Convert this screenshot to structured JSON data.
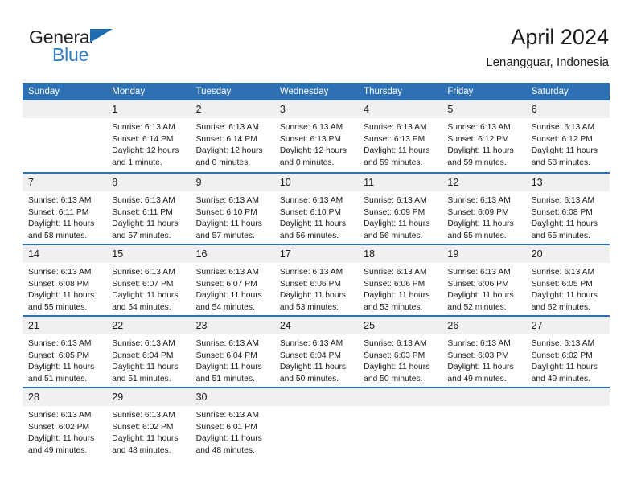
{
  "brand": {
    "name_part1": "General",
    "name_part2": "Blue"
  },
  "header": {
    "title": "April 2024",
    "location": "Lenangguar, Indonesia"
  },
  "colors": {
    "header_blue": "#2e70b4",
    "brand_blue": "#2e7bc4",
    "daynum_band": "#f0f0f0",
    "text": "#1a1a1a"
  },
  "weekdays": [
    "Sunday",
    "Monday",
    "Tuesday",
    "Wednesday",
    "Thursday",
    "Friday",
    "Saturday"
  ],
  "weeks": [
    [
      {
        "day": "",
        "empty": true
      },
      {
        "day": "1",
        "sunrise": "Sunrise: 6:13 AM",
        "sunset": "Sunset: 6:14 PM",
        "daylight1": "Daylight: 12 hours",
        "daylight2": "and 1 minute."
      },
      {
        "day": "2",
        "sunrise": "Sunrise: 6:13 AM",
        "sunset": "Sunset: 6:14 PM",
        "daylight1": "Daylight: 12 hours",
        "daylight2": "and 0 minutes."
      },
      {
        "day": "3",
        "sunrise": "Sunrise: 6:13 AM",
        "sunset": "Sunset: 6:13 PM",
        "daylight1": "Daylight: 12 hours",
        "daylight2": "and 0 minutes."
      },
      {
        "day": "4",
        "sunrise": "Sunrise: 6:13 AM",
        "sunset": "Sunset: 6:13 PM",
        "daylight1": "Daylight: 11 hours",
        "daylight2": "and 59 minutes."
      },
      {
        "day": "5",
        "sunrise": "Sunrise: 6:13 AM",
        "sunset": "Sunset: 6:12 PM",
        "daylight1": "Daylight: 11 hours",
        "daylight2": "and 59 minutes."
      },
      {
        "day": "6",
        "sunrise": "Sunrise: 6:13 AM",
        "sunset": "Sunset: 6:12 PM",
        "daylight1": "Daylight: 11 hours",
        "daylight2": "and 58 minutes."
      }
    ],
    [
      {
        "day": "7",
        "sunrise": "Sunrise: 6:13 AM",
        "sunset": "Sunset: 6:11 PM",
        "daylight1": "Daylight: 11 hours",
        "daylight2": "and 58 minutes."
      },
      {
        "day": "8",
        "sunrise": "Sunrise: 6:13 AM",
        "sunset": "Sunset: 6:11 PM",
        "daylight1": "Daylight: 11 hours",
        "daylight2": "and 57 minutes."
      },
      {
        "day": "9",
        "sunrise": "Sunrise: 6:13 AM",
        "sunset": "Sunset: 6:10 PM",
        "daylight1": "Daylight: 11 hours",
        "daylight2": "and 57 minutes."
      },
      {
        "day": "10",
        "sunrise": "Sunrise: 6:13 AM",
        "sunset": "Sunset: 6:10 PM",
        "daylight1": "Daylight: 11 hours",
        "daylight2": "and 56 minutes."
      },
      {
        "day": "11",
        "sunrise": "Sunrise: 6:13 AM",
        "sunset": "Sunset: 6:09 PM",
        "daylight1": "Daylight: 11 hours",
        "daylight2": "and 56 minutes."
      },
      {
        "day": "12",
        "sunrise": "Sunrise: 6:13 AM",
        "sunset": "Sunset: 6:09 PM",
        "daylight1": "Daylight: 11 hours",
        "daylight2": "and 55 minutes."
      },
      {
        "day": "13",
        "sunrise": "Sunrise: 6:13 AM",
        "sunset": "Sunset: 6:08 PM",
        "daylight1": "Daylight: 11 hours",
        "daylight2": "and 55 minutes."
      }
    ],
    [
      {
        "day": "14",
        "sunrise": "Sunrise: 6:13 AM",
        "sunset": "Sunset: 6:08 PM",
        "daylight1": "Daylight: 11 hours",
        "daylight2": "and 55 minutes."
      },
      {
        "day": "15",
        "sunrise": "Sunrise: 6:13 AM",
        "sunset": "Sunset: 6:07 PM",
        "daylight1": "Daylight: 11 hours",
        "daylight2": "and 54 minutes."
      },
      {
        "day": "16",
        "sunrise": "Sunrise: 6:13 AM",
        "sunset": "Sunset: 6:07 PM",
        "daylight1": "Daylight: 11 hours",
        "daylight2": "and 54 minutes."
      },
      {
        "day": "17",
        "sunrise": "Sunrise: 6:13 AM",
        "sunset": "Sunset: 6:06 PM",
        "daylight1": "Daylight: 11 hours",
        "daylight2": "and 53 minutes."
      },
      {
        "day": "18",
        "sunrise": "Sunrise: 6:13 AM",
        "sunset": "Sunset: 6:06 PM",
        "daylight1": "Daylight: 11 hours",
        "daylight2": "and 53 minutes."
      },
      {
        "day": "19",
        "sunrise": "Sunrise: 6:13 AM",
        "sunset": "Sunset: 6:06 PM",
        "daylight1": "Daylight: 11 hours",
        "daylight2": "and 52 minutes."
      },
      {
        "day": "20",
        "sunrise": "Sunrise: 6:13 AM",
        "sunset": "Sunset: 6:05 PM",
        "daylight1": "Daylight: 11 hours",
        "daylight2": "and 52 minutes."
      }
    ],
    [
      {
        "day": "21",
        "sunrise": "Sunrise: 6:13 AM",
        "sunset": "Sunset: 6:05 PM",
        "daylight1": "Daylight: 11 hours",
        "daylight2": "and 51 minutes."
      },
      {
        "day": "22",
        "sunrise": "Sunrise: 6:13 AM",
        "sunset": "Sunset: 6:04 PM",
        "daylight1": "Daylight: 11 hours",
        "daylight2": "and 51 minutes."
      },
      {
        "day": "23",
        "sunrise": "Sunrise: 6:13 AM",
        "sunset": "Sunset: 6:04 PM",
        "daylight1": "Daylight: 11 hours",
        "daylight2": "and 51 minutes."
      },
      {
        "day": "24",
        "sunrise": "Sunrise: 6:13 AM",
        "sunset": "Sunset: 6:04 PM",
        "daylight1": "Daylight: 11 hours",
        "daylight2": "and 50 minutes."
      },
      {
        "day": "25",
        "sunrise": "Sunrise: 6:13 AM",
        "sunset": "Sunset: 6:03 PM",
        "daylight1": "Daylight: 11 hours",
        "daylight2": "and 50 minutes."
      },
      {
        "day": "26",
        "sunrise": "Sunrise: 6:13 AM",
        "sunset": "Sunset: 6:03 PM",
        "daylight1": "Daylight: 11 hours",
        "daylight2": "and 49 minutes."
      },
      {
        "day": "27",
        "sunrise": "Sunrise: 6:13 AM",
        "sunset": "Sunset: 6:02 PM",
        "daylight1": "Daylight: 11 hours",
        "daylight2": "and 49 minutes."
      }
    ],
    [
      {
        "day": "28",
        "sunrise": "Sunrise: 6:13 AM",
        "sunset": "Sunset: 6:02 PM",
        "daylight1": "Daylight: 11 hours",
        "daylight2": "and 49 minutes."
      },
      {
        "day": "29",
        "sunrise": "Sunrise: 6:13 AM",
        "sunset": "Sunset: 6:02 PM",
        "daylight1": "Daylight: 11 hours",
        "daylight2": "and 48 minutes."
      },
      {
        "day": "30",
        "sunrise": "Sunrise: 6:13 AM",
        "sunset": "Sunset: 6:01 PM",
        "daylight1": "Daylight: 11 hours",
        "daylight2": "and 48 minutes."
      },
      {
        "day": "",
        "empty": true
      },
      {
        "day": "",
        "empty": true
      },
      {
        "day": "",
        "empty": true
      },
      {
        "day": "",
        "empty": true
      }
    ]
  ]
}
